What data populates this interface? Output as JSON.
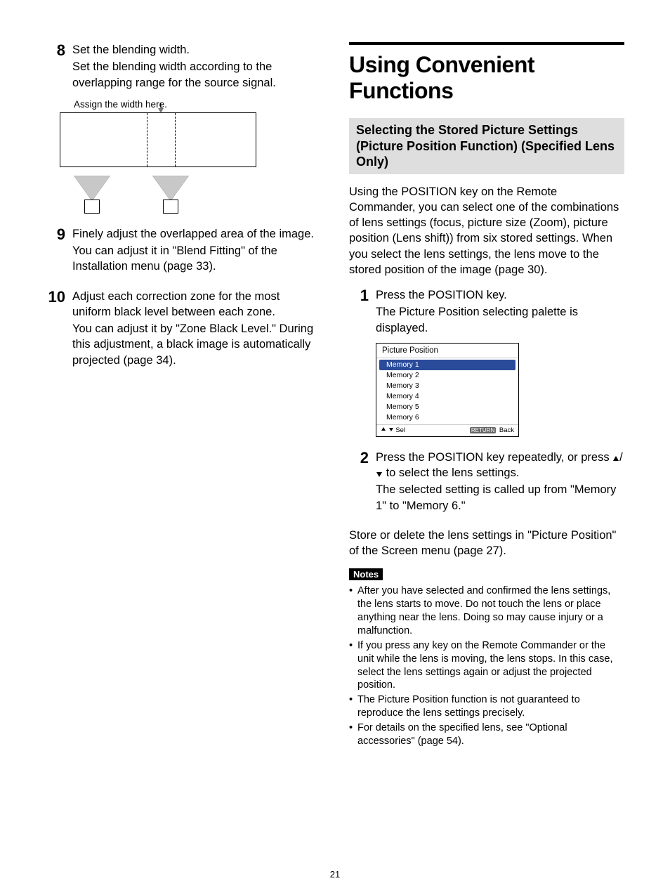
{
  "pageNumber": "21",
  "left": {
    "steps": [
      {
        "num": "8",
        "lead": "Set the blending width.",
        "sub": "Set the blending width according to the overlapping range for the source signal.",
        "diagramLabel": "Assign the width here."
      },
      {
        "num": "9",
        "lead": "Finely adjust the overlapped area of the image.",
        "sub": "You can adjust it in \"Blend Fitting\" of the Installation menu (page 33)."
      },
      {
        "num": "10",
        "lead": "Adjust each correction zone for the most uniform black level between each zone.",
        "sub": "You can adjust it by \"Zone Black Level.\" During this adjustment, a black image is automatically projected (page 34)."
      }
    ]
  },
  "right": {
    "heading": "Using Convenient Functions",
    "subHeading": "Selecting the Stored Picture Settings (Picture Position Function) (Specified Lens Only)",
    "intro": "Using the POSITION key on the Remote Commander, you can select one of the combinations of lens settings (focus, picture size (Zoom), picture position (Lens shift)) from six stored settings. When you select the lens settings, the lens move to the stored position of the image (page 30).",
    "steps": [
      {
        "num": "1",
        "lead": "Press the POSITION key.",
        "sub": "The Picture Position selecting palette is displayed."
      },
      {
        "num": "2",
        "leadPrefix": "Press the POSITION key repeatedly, or press ",
        "leadSuffix": " to select the lens settings.",
        "sub": "The selected setting is called up from \"Memory 1\" to \"Memory 6.\""
      }
    ],
    "palette": {
      "title": "Picture Position",
      "items": [
        "Memory 1",
        "Memory 2",
        "Memory 3",
        "Memory 4",
        "Memory 5",
        "Memory 6"
      ],
      "selectedIndex": 0,
      "footerLeft": "Sel",
      "footerRightBadge": "RETURN",
      "footerRight": "Back"
    },
    "storeDelete": "Store or delete the lens settings in \"Picture Position\" of the Screen menu (page 27).",
    "notesLabel": "Notes",
    "notes": [
      "After you have selected and confirmed the lens settings, the lens starts to move. Do not touch the lens or place anything near the lens. Doing so may cause injury or a malfunction.",
      "If you press any key on the Remote Commander or the unit while the lens is moving, the lens stops. In this case, select the lens settings again or adjust the projected position.",
      "The Picture Position function is not guaranteed to reproduce the lens settings precisely.",
      "For details on the specified lens, see \"Optional accessories\" (page 54)."
    ]
  }
}
